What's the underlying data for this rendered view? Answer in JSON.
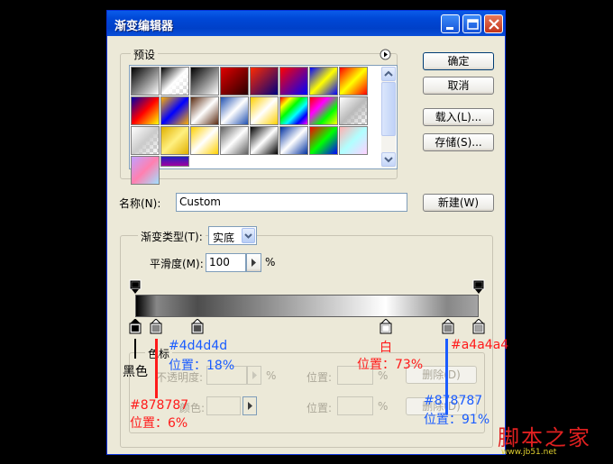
{
  "window": {
    "title": "渐变编辑器"
  },
  "presets": {
    "legend": "预设",
    "swatches": [
      "linear-gradient(135deg,#000,#fff)",
      "linear-gradient(135deg,#000,#fff)",
      "linear-gradient(135deg,#000,#fff)",
      "linear-gradient(135deg,#e00000,#2a0000)",
      "linear-gradient(135deg,#ff2a00,#000080)",
      "linear-gradient(135deg,#ff0000,#0000ff)",
      "linear-gradient(135deg,#0000ff,#ffff00,#0000ff)",
      "linear-gradient(135deg,#ff0000,#ffff00,#ff0000)",
      "linear-gradient(135deg,#0000aa,#ff0000,#ffff00)",
      "linear-gradient(135deg,#ffb000,#0000ff,#ffb000)",
      "linear-gradient(135deg,#5a2a10,#ffffff,#5a2a10)",
      "linear-gradient(135deg,#2050b0,#ffffff,#2050b0)",
      "linear-gradient(135deg,#ffd000,#ffffff,#ffd000)",
      "linear-gradient(135deg,#ff0000,#ffff00,#00ff00,#00ffff,#0000ff,#ff00ff)",
      "linear-gradient(135deg,#ff0000,#ff00ff,#00ff00,#ffff00)",
      "linear-gradient(135deg,#ffffff,#bbbbbb)",
      "linear-gradient(135deg,#ffffff,#cccccc)",
      "linear-gradient(135deg,#e0b000,#fff080,#e0b000)",
      "linear-gradient(135deg,#ffd000,#ffffff,#ffd000)",
      "linear-gradient(135deg,#606060,#ffffff,#606060)",
      "linear-gradient(135deg,#000,#fff,#000)",
      "linear-gradient(135deg,#0030a0,#ffffff,#0030a0)",
      "linear-gradient(135deg,#ff0000,#00ff00,#0000ff)",
      "linear-gradient(135deg,#ffb0b0,#b0ffff,#ffd0ff)",
      "linear-gradient(135deg,#c0a0ff,#ff80b0,#a0e0ff)",
      "linear-gradient(#2020c0,#a000a0)"
    ]
  },
  "buttons": {
    "ok": "确定",
    "cancel": "取消",
    "load": "载入(L)...",
    "save": "存储(S)...",
    "new": "新建(W)",
    "delete": "删除(D)"
  },
  "name": {
    "label": "名称(N):",
    "value": "Custom"
  },
  "gradient_type": {
    "label": "渐变类型(T):",
    "value": "实底"
  },
  "smoothness": {
    "label": "平滑度(M):",
    "value": "100",
    "unit": "%"
  },
  "stops_group": {
    "legend": "色标",
    "opacity_label": "不透明度:",
    "opacity_unit": "%",
    "location_label": "位置:",
    "location_unit": "%",
    "color_label": "颜色:"
  },
  "color_stops": [
    {
      "pos": 0,
      "color": "#000000"
    },
    {
      "pos": 6,
      "color": "#878787"
    },
    {
      "pos": 18,
      "color": "#4d4d4d"
    },
    {
      "pos": 73,
      "color": "#ffffff"
    },
    {
      "pos": 91,
      "color": "#878787"
    },
    {
      "pos": 100,
      "color": "#a4a4a4"
    }
  ],
  "opacity_stops": [
    0,
    100
  ],
  "annotations": {
    "black_name": "黑色",
    "c1_hex": "#878787",
    "c1_pos": "位置：6%",
    "c2_hex": "#4d4d4d",
    "c2_pos": "位置：18%",
    "c3_name": "白",
    "c3_pos": "位置：73%",
    "c4_hex": "#a4a4a4",
    "c5_hex": "#878787",
    "c5_pos": "位置：91%"
  },
  "watermark": {
    "text": "脚本之家",
    "url": "www.jb51.net"
  }
}
